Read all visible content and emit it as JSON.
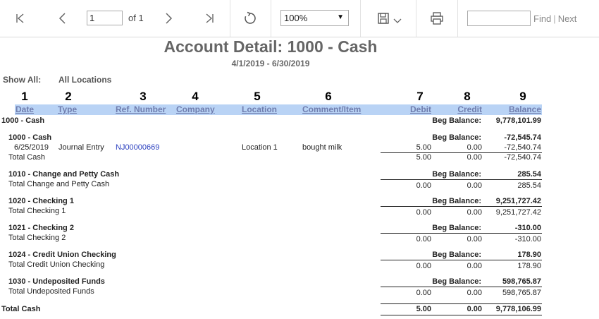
{
  "toolbar": {
    "page_value": "1",
    "of_label": "of 1",
    "zoom": "100%",
    "find_placeholder": "",
    "find_label": "Find",
    "next_label": "Next"
  },
  "report": {
    "title": "Account Detail: 1000 - Cash",
    "date_range": "4/1/2019 - 6/30/2019",
    "show_all_label": "Show All:",
    "show_all_value": "All Locations",
    "column_numbers": [
      "1",
      "2",
      "3",
      "4",
      "5",
      "6",
      "7",
      "8",
      "9"
    ],
    "columns": [
      "Date",
      "Type",
      "Ref. Number",
      "Company",
      "Location",
      "Comment/Item",
      "Debit",
      "Credit",
      "Balance"
    ],
    "top_account": "1000 - Cash",
    "beg_label": "Beg Balance:",
    "top_beg_balance": "9,778,101.99",
    "groups": [
      {
        "name": "1000 - Cash",
        "beg_balance": "-72,545.74",
        "transaction": {
          "date": "6/25/2019",
          "type": "Journal Entry",
          "ref": "NJ00000669",
          "location": "Location 1",
          "comment": "bought milk",
          "debit": "5.00",
          "credit": "0.00",
          "balance": "-72,540.74"
        },
        "total_label": "Total Cash",
        "total_debit": "5.00",
        "total_credit": "0.00",
        "total_balance": "-72,540.74"
      },
      {
        "name": "1010 - Change and Petty Cash",
        "beg_balance": "285.54",
        "total_label": "Total Change and Petty Cash",
        "total_debit": "0.00",
        "total_credit": "0.00",
        "total_balance": "285.54"
      },
      {
        "name": "1020 - Checking 1",
        "beg_balance": "9,251,727.42",
        "total_label": "Total Checking 1",
        "total_debit": "0.00",
        "total_credit": "0.00",
        "total_balance": "9,251,727.42"
      },
      {
        "name": "1021 - Checking 2",
        "beg_balance": "-310.00",
        "total_label": "Total Checking 2",
        "total_debit": "0.00",
        "total_credit": "0.00",
        "total_balance": "-310.00"
      },
      {
        "name": "1024 - Credit Union Checking",
        "beg_balance": "178.90",
        "total_label": "Total Credit Union Checking",
        "total_debit": "0.00",
        "total_credit": "0.00",
        "total_balance": "178.90"
      },
      {
        "name": "1030 - Undeposited Funds",
        "beg_balance": "598,765.87",
        "total_label": "Total Undeposited Funds",
        "total_debit": "0.00",
        "total_credit": "0.00",
        "total_balance": "598,765.87"
      }
    ],
    "grand_total_label": "Total Cash",
    "grand_total_debit": "5.00",
    "grand_total_credit": "0.00",
    "grand_total_balance": "9,778,106.99"
  }
}
